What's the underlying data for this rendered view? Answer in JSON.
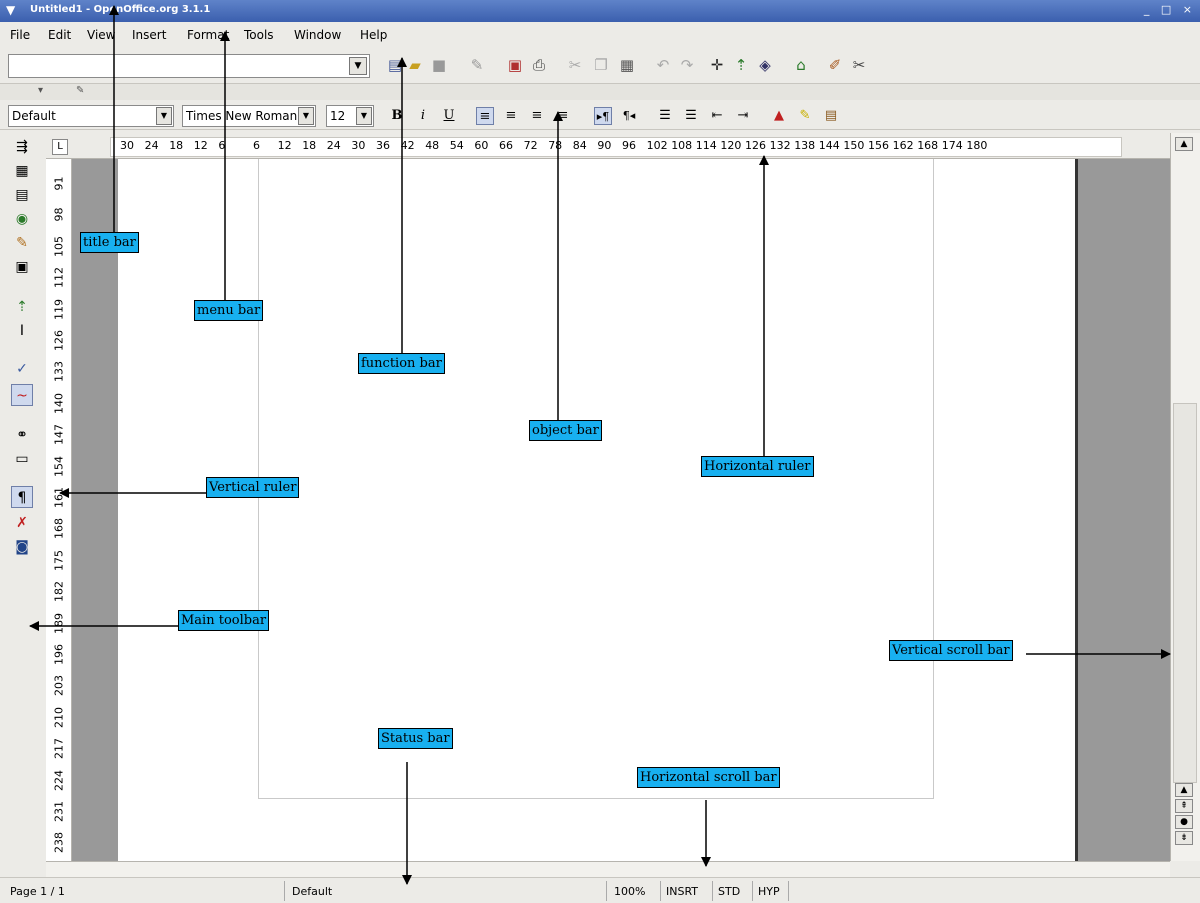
{
  "window": {
    "title": "Untitled1 - OpenOffice.org 3.1.1",
    "controls": "_ □ ×"
  },
  "menu": [
    "File",
    "Edit",
    "View",
    "Insert",
    "Format",
    "Tools",
    "Window",
    "Help"
  ],
  "object_bar": {
    "paragraph_style": "Default",
    "font_name": "Times New Roman",
    "font_size": "12",
    "bold": "B",
    "italic": "i",
    "underline": "U"
  },
  "hruler": {
    "ticks": [
      "30",
      "24",
      "18",
      "12",
      "6",
      "6",
      "12",
      "18",
      "24",
      "30",
      "36",
      "42",
      "48",
      "54",
      "60",
      "66",
      "72",
      "78",
      "84",
      "90",
      "96",
      "102",
      "108",
      "114",
      "120",
      "126",
      "132",
      "138",
      "144",
      "150",
      "156",
      "162",
      "168",
      "174",
      "180"
    ]
  },
  "vruler": {
    "ticks": [
      "91",
      "98",
      "105",
      "112",
      "119",
      "126",
      "133",
      "140",
      "147",
      "154",
      "161",
      "168",
      "175",
      "182",
      "189",
      "196",
      "203",
      "210",
      "217",
      "224",
      "231",
      "238"
    ]
  },
  "status": {
    "page": "Page 1 / 1",
    "style": "Default",
    "zoom": "100%",
    "insert": "INSRT",
    "selection": "STD",
    "hyperlink": "HYP"
  },
  "annotations": {
    "title_bar": "title bar",
    "menu_bar": "menu bar",
    "function_bar": "function bar",
    "object_bar": "object bar",
    "horizontal_ruler": "Horizontal ruler",
    "vertical_ruler": "Vertical ruler",
    "main_toolbar": "Main toolbar",
    "vertical_scroll_bar": "Vertical scroll bar",
    "status_bar": "Status bar",
    "horizontal_scroll_bar": "Horizontal scroll bar"
  },
  "colors": {
    "title_gradient": "#3b5fae",
    "label_bg": "#18b0f0",
    "doc_bg": "#999999"
  }
}
